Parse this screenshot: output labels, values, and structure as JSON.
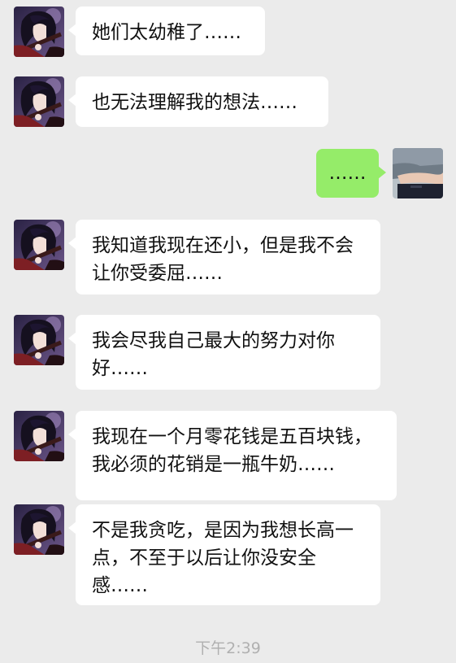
{
  "messages": [
    {
      "sender": "contact",
      "text": "她们太幼稚了……"
    },
    {
      "sender": "contact",
      "text": "也无法理解我的想法……"
    },
    {
      "sender": "me",
      "text": "……"
    },
    {
      "sender": "contact",
      "text": "我知道我现在还小，但是我不会让你受委屈……"
    },
    {
      "sender": "contact",
      "text": "我会尽我自己最大的努力对你好……"
    },
    {
      "sender": "contact",
      "text": "我现在一个月零花钱是五百块钱，我必须的花销是一瓶牛奶……"
    },
    {
      "sender": "contact",
      "text": "不是我贪吃，是因为我想长高一点，不至于以后让你没安全感……"
    }
  ],
  "timestamp": "下午2:39",
  "colors": {
    "background": "#ebebeb",
    "incoming_bubble": "#ffffff",
    "outgoing_bubble": "#95ec69",
    "timestamp_text": "#b0b0b0"
  },
  "icons": {
    "contact_avatar": "anime-avatar-icon",
    "user_avatar": "user-photo-avatar-icon"
  }
}
